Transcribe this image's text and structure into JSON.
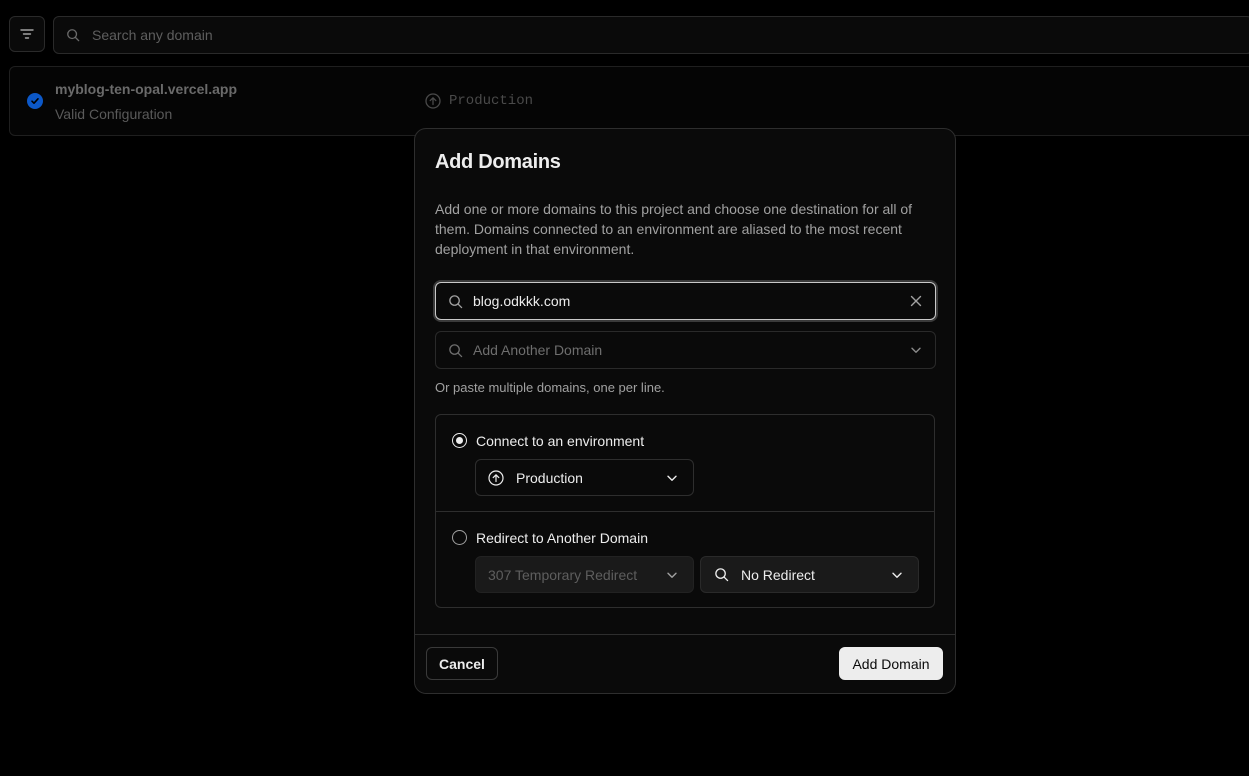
{
  "background": {
    "search_placeholder": "Search any domain",
    "domain_row": {
      "name": "myblog-ten-opal.vercel.app",
      "status": "Valid Configuration",
      "environment": "Production"
    }
  },
  "modal": {
    "title": "Add Domains",
    "description": "Add one or more domains to this project and choose one destination for all of them. Domains connected to an environment are aliased to the most recent deployment in that environment.",
    "domain_input_value": "blog.odkkk.com",
    "add_another_placeholder": "Add Another Domain",
    "hint": "Or paste multiple domains, one per line.",
    "option_connect": {
      "label": "Connect to an environment",
      "selected": true,
      "environment": "Production"
    },
    "option_redirect": {
      "label": "Redirect to Another Domain",
      "selected": false,
      "redirect_type": "307 Temporary Redirect",
      "redirect_target": "No Redirect"
    },
    "cancel_label": "Cancel",
    "submit_label": "Add Domain"
  },
  "colors": {
    "background": "#000000",
    "surface": "#0a0a0a",
    "border": "#2e2e2e",
    "text": "#ededed",
    "muted_text": "#a1a1a1",
    "check_blue": "#0c58c8"
  }
}
